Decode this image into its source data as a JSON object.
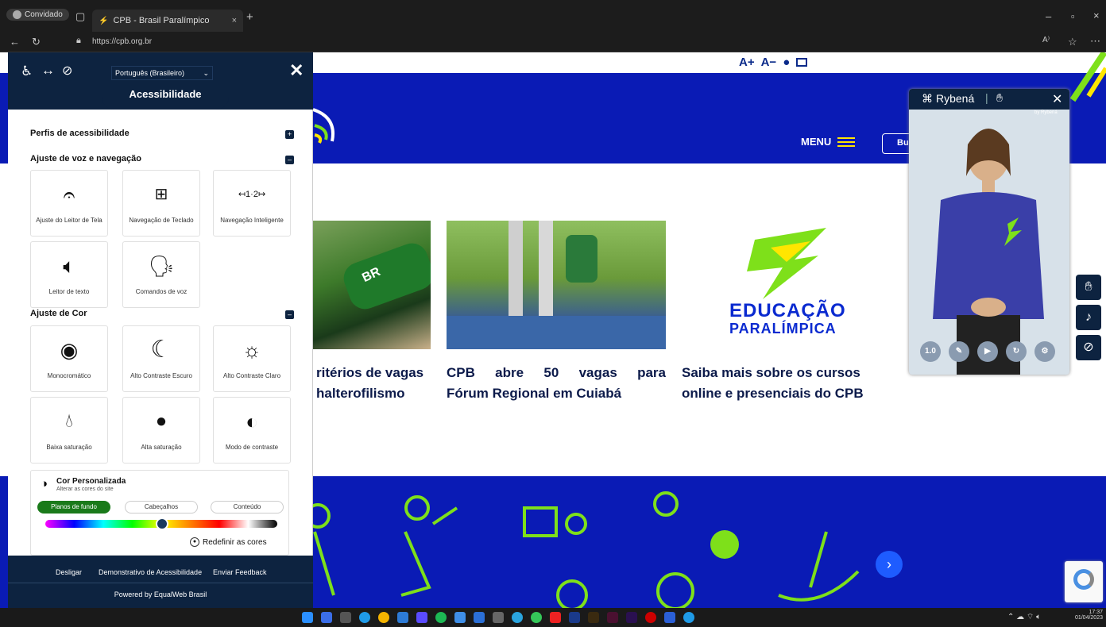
{
  "browser": {
    "profile_label": "Convidado",
    "tab_title": "CPB - Brasil Paralímpico",
    "url": "https://cpb.org.br"
  },
  "site": {
    "font_controls": [
      "A+",
      "A−"
    ],
    "menu_label": "MENU",
    "search_label": "Bu",
    "cards": [
      {
        "title_line1": "ritérios de vagas",
        "title_line2": "halterofilismo"
      },
      {
        "title_line1": "CPB abre 50 vagas para",
        "title_line2": "Fórum Regional em Cuiabá"
      },
      {
        "title_line1": "Saiba mais sobre os cursos",
        "title_line2": "online e presenciais do CPB"
      }
    ],
    "edu_logo_line1": "EDUCAÇÃO",
    "edu_logo_line2": "PARALÍMPICA",
    "colors": {
      "brand_blue": "#0a1bb5",
      "accent_green": "#7ee01a",
      "accent_yellow": "#ffe600"
    }
  },
  "accessibility": {
    "language": "Português (Brasileiro)",
    "panel_title": "Acessibilidade",
    "sections": {
      "profiles": "Perfis de acessibilidade",
      "voice_nav": "Ajuste de voz e navegação",
      "color": "Ajuste de Cor"
    },
    "voice_tiles": [
      {
        "label": "Ajuste do Leitor de Tela",
        "icon": "ear-icon"
      },
      {
        "label": "Navegação de Teclado",
        "icon": "keyboard-icon"
      },
      {
        "label": "Navegação Inteligente",
        "icon": "smart-nav-icon",
        "glyph": "↤1·2↦"
      },
      {
        "label": "Leitor de texto",
        "icon": "speaker-icon"
      },
      {
        "label": "Comandos de voz",
        "icon": "voice-command-icon"
      }
    ],
    "color_tiles": [
      {
        "label": "Monocromático",
        "icon": "eye-icon"
      },
      {
        "label": "Alto Contraste Escuro",
        "icon": "moon-icon"
      },
      {
        "label": "Alto Contraste Claro",
        "icon": "sun-icon"
      },
      {
        "label": "Baixa saturação",
        "icon": "low-saturation-icon"
      },
      {
        "label": "Alta saturação",
        "icon": "high-saturation-icon"
      },
      {
        "label": "Modo de contraste",
        "icon": "contrast-mode-icon"
      }
    ],
    "custom_color": {
      "title": "Cor Personalizada",
      "subtitle": "Alterar as cores do site",
      "buttons": [
        "Planos de fundo",
        "Cabeçalhos",
        "Conteúdo"
      ],
      "reset_label": "Redefinir as cores"
    },
    "footer": {
      "links": [
        "Desligar",
        "Demonstrativo de Acessibilidade",
        "Enviar Feedback"
      ],
      "powered_by": "Powered by EqualWeb Brasil"
    }
  },
  "rybena": {
    "title": "Rybená",
    "watermark": "by Rybená",
    "speed": "1.0"
  },
  "taskbar": {
    "time": "17:37",
    "date": "01/04/2023"
  }
}
